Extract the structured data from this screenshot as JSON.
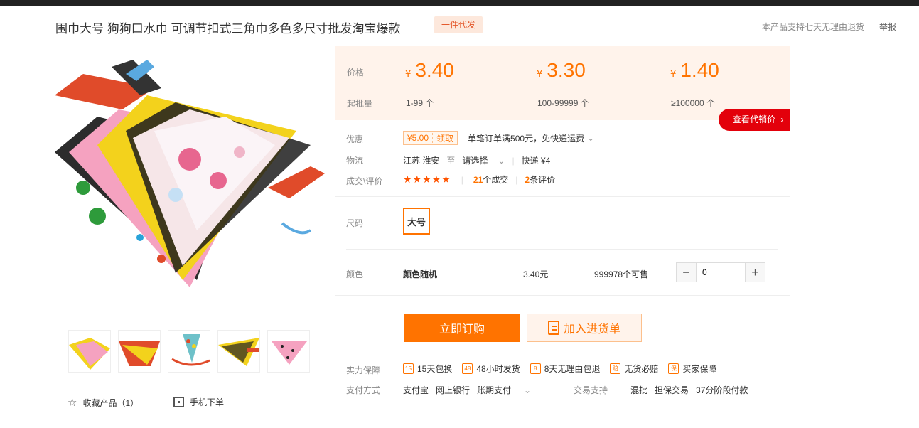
{
  "product": {
    "title": "围巾大号 狗狗口水巾 可调节扣式三角巾多色多尺寸批发淘宝爆款",
    "tag": "一件代发",
    "return_policy": "本产品支持七天无理由退货",
    "report": "举报"
  },
  "gallery": {
    "thumb_count": 5,
    "favorite_label": "收藏产品（1）",
    "mobile_order_label": "手机下单"
  },
  "pricing": {
    "price_label": "价格",
    "moq_label": "起批量",
    "currency": "¥",
    "tiers": [
      {
        "price": "3.40",
        "range": "1-99 个"
      },
      {
        "price": "3.30",
        "range": "100-99999 个"
      },
      {
        "price": "1.40",
        "range": "≥100000 个"
      }
    ],
    "agent_price_button": "查看代销价"
  },
  "promo": {
    "label": "优惠",
    "coupon_amount": "¥5.00",
    "coupon_get": "领取",
    "shipping_text": "单笔订单满500元，免快递运费"
  },
  "logistics": {
    "label": "物流",
    "origin": "江苏 淮安",
    "to": "至",
    "destination": "请选择",
    "express": "快递 ¥4"
  },
  "rating": {
    "label": "成交\\评价",
    "stars": "★★★★★",
    "deals_count": "21",
    "deals_suffix": "个成交",
    "reviews_count": "2",
    "reviews_suffix": "条评价"
  },
  "size": {
    "label": "尺码",
    "option": "大号"
  },
  "color": {
    "label": "颜色",
    "option": "颜色随机",
    "price": "3.40元",
    "stock": "999978个可售",
    "quantity": "0",
    "minus": "−",
    "plus": "+"
  },
  "actions": {
    "buy_now": "立即订购",
    "add_to_list": "加入进货单"
  },
  "guarantees": {
    "label": "实力保障",
    "items": [
      {
        "icon": "15",
        "text": "15天包换"
      },
      {
        "icon": "48",
        "text": "48小时发货"
      },
      {
        "icon": "8",
        "text": "8天无理由包退"
      },
      {
        "icon": "赔",
        "text": "无货必赔"
      },
      {
        "icon": "保",
        "text": "买家保障"
      }
    ]
  },
  "payment": {
    "label": "支付方式",
    "methods": [
      "支付宝",
      "网上银行",
      "账期支付"
    ],
    "trade_label": "交易支持",
    "trade_items": [
      "混批",
      "担保交易",
      "37分阶段付款"
    ]
  }
}
